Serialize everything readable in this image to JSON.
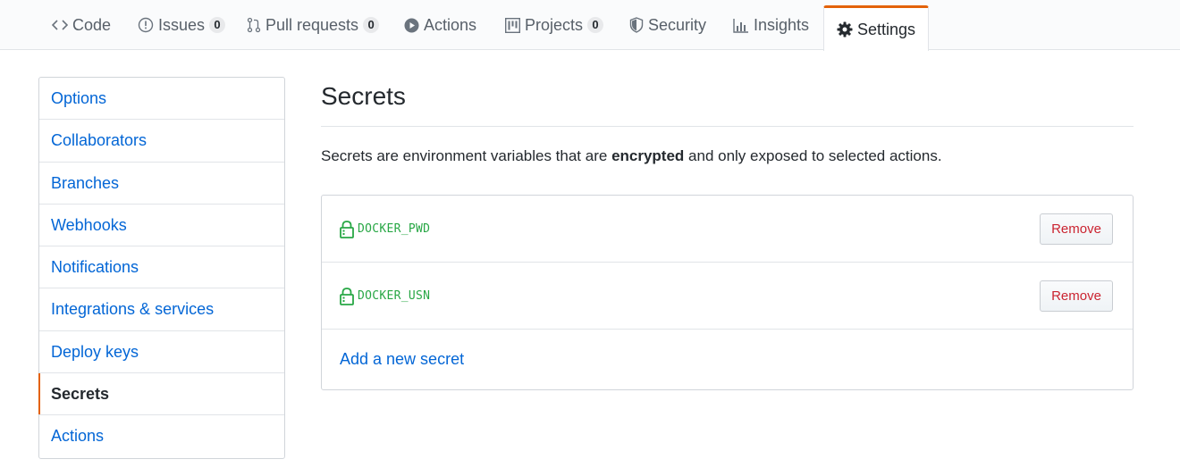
{
  "nav": {
    "tabs": [
      {
        "label": "Code",
        "icon": "code-icon"
      },
      {
        "label": "Issues",
        "icon": "issue-opened-icon",
        "count": "0"
      },
      {
        "label": "Pull requests",
        "icon": "git-pull-request-icon",
        "count": "0"
      },
      {
        "label": "Actions",
        "icon": "play-icon"
      },
      {
        "label": "Projects",
        "icon": "project-icon",
        "count": "0"
      },
      {
        "label": "Security",
        "icon": "shield-icon"
      },
      {
        "label": "Insights",
        "icon": "graph-icon"
      },
      {
        "label": "Settings",
        "icon": "gear-icon",
        "selected": true
      }
    ],
    "accent_color": "#e36209"
  },
  "sidebar": {
    "items": [
      {
        "label": "Options"
      },
      {
        "label": "Collaborators"
      },
      {
        "label": "Branches"
      },
      {
        "label": "Webhooks"
      },
      {
        "label": "Notifications"
      },
      {
        "label": "Integrations & services"
      },
      {
        "label": "Deploy keys"
      },
      {
        "label": "Secrets",
        "selected": true
      },
      {
        "label": "Actions"
      }
    ]
  },
  "main": {
    "title": "Secrets",
    "description": {
      "before": "Secrets are environment variables that are ",
      "emphasis": "encrypted",
      "after": " and only exposed to selected actions."
    },
    "secrets": [
      {
        "name": "DOCKER_PWD",
        "icon": "lock-icon",
        "action_label": "Remove"
      },
      {
        "name": "DOCKER_USN",
        "icon": "lock-icon",
        "action_label": "Remove"
      }
    ],
    "add_label": "Add a new secret"
  },
  "colors": {
    "link": "#0366d6",
    "secret_name": "#28a745",
    "danger": "#cb2431"
  }
}
